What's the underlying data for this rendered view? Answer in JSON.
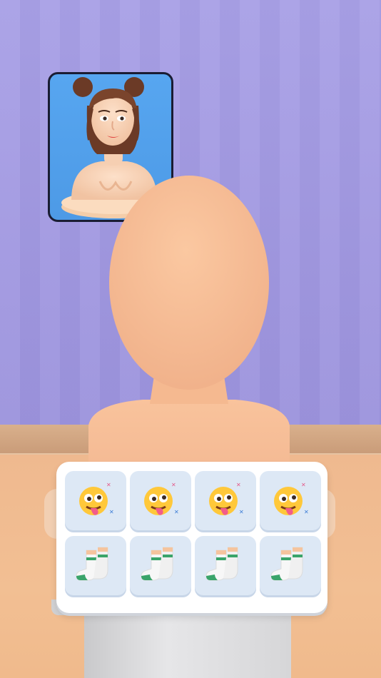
{
  "scene": {
    "wall_color": "#a59cdf",
    "floor_color": "#f2bf93",
    "skin_color": "#f7bf98"
  },
  "reference_portrait": {
    "background": "#4f9ee8",
    "icon": "woman-portrait-icon"
  },
  "item_panel": {
    "rows": [
      {
        "row": "emoji",
        "items": [
          {
            "icon": "tongue-out-emoji-icon"
          },
          {
            "icon": "tongue-out-emoji-icon"
          },
          {
            "icon": "tongue-out-emoji-icon"
          },
          {
            "icon": "tongue-out-emoji-icon"
          }
        ]
      },
      {
        "row": "socks",
        "items": [
          {
            "icon": "socks-icon"
          },
          {
            "icon": "socks-icon"
          },
          {
            "icon": "socks-icon"
          },
          {
            "icon": "socks-icon"
          }
        ]
      }
    ]
  }
}
